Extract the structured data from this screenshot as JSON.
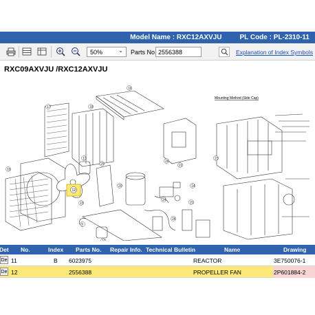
{
  "title_bar": {
    "model_name": "Model Name : RXC12AXVJU",
    "pl_code": "PL Code : PL-2310-11"
  },
  "toolbar": {
    "icons": [
      "print-icon",
      "layout-rows-icon",
      "layout-columns-icon",
      "zoom-in-icon",
      "zoom-out-icon",
      "search-icon"
    ],
    "zoom_value": "50%",
    "parts_no_label": "Parts No.",
    "parts_no_value": "2556388",
    "explain_link": "Explanation of Index Symbols"
  },
  "drawing": {
    "heading": "RXC09AXVJU /RXC12AXVJU",
    "mounting_title": "Mounting Method (Side Cap)",
    "highlighted_part_label": "12"
  },
  "table": {
    "headers": {
      "det": "Det",
      "no": "No.",
      "index": "Index",
      "parts_no": "Parts No.",
      "repair_info": "Repair Info.",
      "tech_bulletin": "Technical Bulletin",
      "name": "Name",
      "drawing_no": "Drawing No."
    },
    "rows": [
      {
        "det": "De",
        "no": "11",
        "index": "B",
        "parts_no": "6023975",
        "name": "REACTOR",
        "drawing_no": "3E750076-1",
        "highlighted": false
      },
      {
        "det": "De",
        "no": "12",
        "index": "",
        "parts_no": "2556388",
        "name": "PROPELLER FAN",
        "drawing_no": "2P601884-2",
        "highlighted": true
      }
    ]
  },
  "colors": {
    "accent_blue": "#2f63ad",
    "highlight_yellow": "#fde978",
    "highlight_pink": "#f7d5d5",
    "link": "#1a4fbf"
  }
}
